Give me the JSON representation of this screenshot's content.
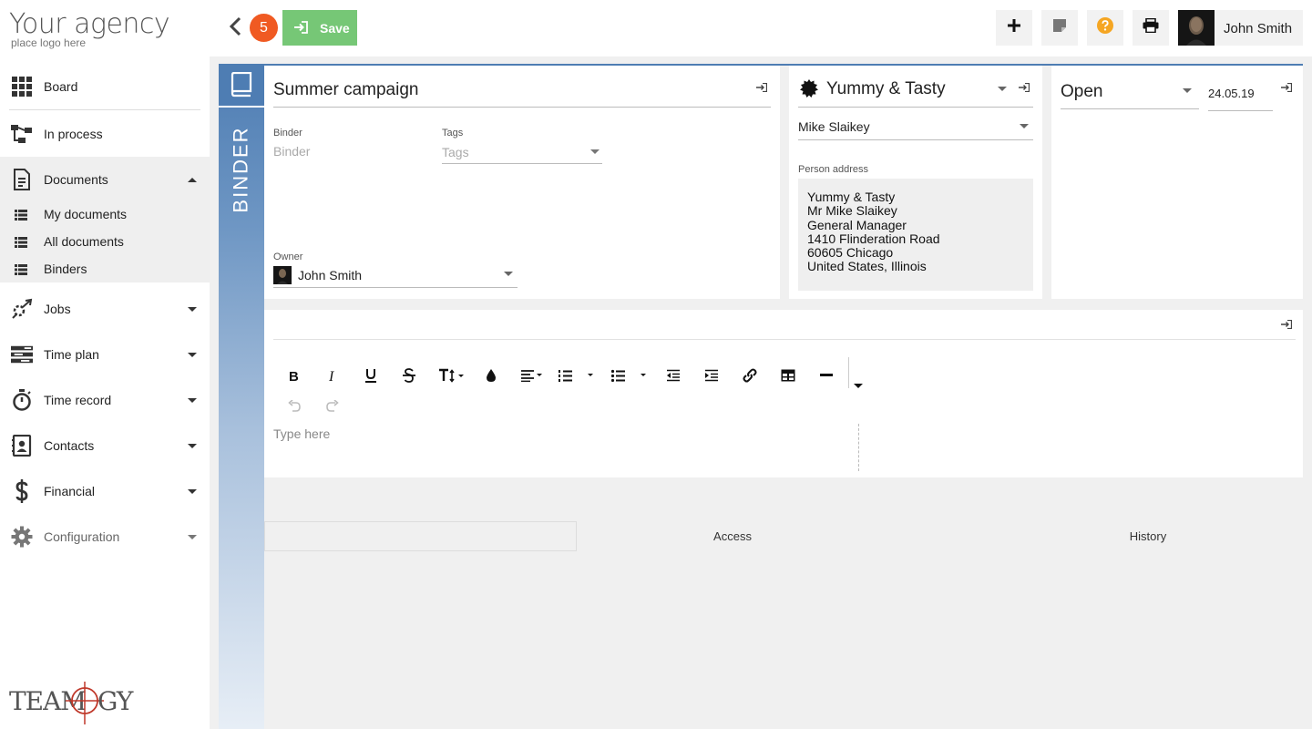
{
  "brand": {
    "title": "Your agency",
    "subtitle": "place logo here",
    "footer_logo": "TEAMOGY"
  },
  "sidebar": {
    "items": [
      {
        "label": "Board",
        "icon": "grid-icon"
      },
      {
        "label": "In process",
        "icon": "flow-icon"
      },
      {
        "label": "Documents",
        "icon": "document-icon",
        "expanded": true
      },
      {
        "label": "Jobs",
        "icon": "jobs-icon"
      },
      {
        "label": "Time plan",
        "icon": "time-plan-icon"
      },
      {
        "label": "Time record",
        "icon": "stopwatch-icon"
      },
      {
        "label": "Contacts",
        "icon": "contacts-icon"
      },
      {
        "label": "Financial",
        "icon": "dollar-icon"
      },
      {
        "label": "Configuration",
        "icon": "gear-icon"
      }
    ],
    "documents_sub": [
      {
        "label": "My documents"
      },
      {
        "label": "All documents"
      },
      {
        "label": "Binders"
      }
    ]
  },
  "topbar": {
    "badge": "5",
    "save_label": "Save",
    "user_name": "John Smith"
  },
  "binder": {
    "strip_label": "BINDER",
    "title": "Summer campaign",
    "binder_label": "Binder",
    "binder_placeholder": "Binder",
    "tags_label": "Tags",
    "tags_placeholder": "Tags",
    "owner_label": "Owner",
    "owner_value": "John Smith"
  },
  "client": {
    "company": "Yummy & Tasty",
    "person": "Mike Slaikey",
    "address_label": "Person address",
    "address_lines": [
      "Yummy & Tasty",
      "Mr  Mike Slaikey",
      "General Manager",
      "1410  Flinderation Road",
      "60605 Chicago",
      "United States, Illinois"
    ]
  },
  "status": {
    "value": "Open",
    "date": "24.05.19"
  },
  "editor": {
    "placeholder": "Type here"
  },
  "tabs": [
    {
      "label": "",
      "active": true
    },
    {
      "label": "Access"
    },
    {
      "label": "History"
    }
  ],
  "colors": {
    "accent": "#4e7db3",
    "save": "#76c776",
    "badge": "#f05a22",
    "help": "#f5a623"
  }
}
